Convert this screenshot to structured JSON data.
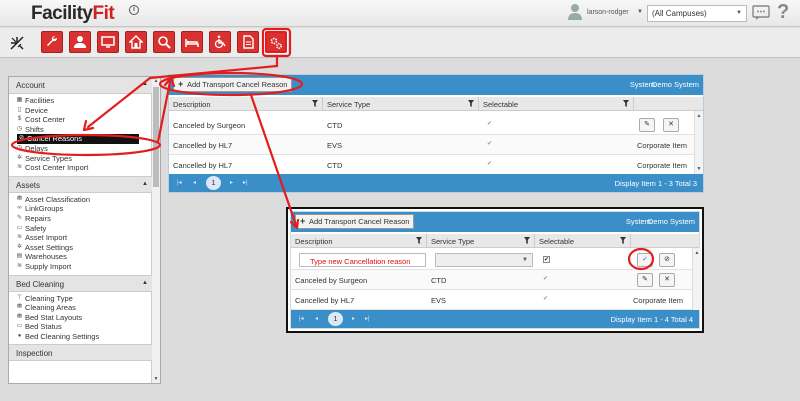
{
  "header": {
    "logo_main": "Facility",
    "logo_accent": "Fit",
    "logo_info": "i",
    "username": "larson-rodger",
    "campus_selected": "(All Campuses)",
    "help": "?"
  },
  "toolbar": {
    "buttons": [
      {
        "name": "wrench-icon"
      },
      {
        "name": "user-icon"
      },
      {
        "name": "monitor-icon"
      },
      {
        "name": "home-icon"
      },
      {
        "name": "search-icon"
      },
      {
        "name": "bed-icon"
      },
      {
        "name": "wheelchair-icon"
      },
      {
        "name": "document-icon"
      },
      {
        "name": "gears-icon"
      }
    ]
  },
  "sidebar": {
    "sections": [
      {
        "title": "Account",
        "items": [
          "Facilities",
          "Device",
          "Cost Center",
          "Shifts",
          "Cancel Reasons",
          "Delays",
          "Service Types",
          "Cost Center Import"
        ]
      },
      {
        "title": "Assets",
        "items": [
          "Asset Classification",
          "LinkGroups",
          "Repairs",
          "Safety",
          "Asset Import",
          "Asset Settings",
          "Warehouses",
          "Supply Import"
        ]
      },
      {
        "title": "Bed Cleaning",
        "items": [
          "Cleaning Type",
          "Cleaning Areas",
          "Bed Stat Layouts",
          "Bed Status",
          "Bed Cleaning Settings"
        ]
      },
      {
        "title": "Inspection",
        "items": []
      }
    ],
    "selected": "Cancel Reasons"
  },
  "grid1": {
    "add_label": "Add Transport Cancel Reason",
    "system_label": "System:",
    "system_value": "Demo System",
    "columns": [
      "Description",
      "Service Type",
      "Selectable"
    ],
    "rows": [
      {
        "description": "Canceled by Surgeon",
        "service_type": "CTD",
        "action": "buttons"
      },
      {
        "description": "Cancelled by HL7",
        "service_type": "EVS",
        "action": "Corporate Item"
      },
      {
        "description": "Cancelled by HL7",
        "service_type": "CTD",
        "action": "Corporate Item"
      }
    ],
    "page": "1",
    "display": "Display Item 1 - 3 Total 3"
  },
  "grid2": {
    "add_label": "Add Transport Cancel Reason",
    "system_label": "System:",
    "system_value": "Demo System",
    "columns": [
      "Description",
      "Service Type",
      "Selectable"
    ],
    "new_row_placeholder": "Type new Cancellation reason",
    "rows": [
      {
        "description": "Canceled by Surgeon",
        "service_type": "CTD",
        "action": "buttons"
      },
      {
        "description": "Cancelled by HL7",
        "service_type": "EVS",
        "action": "Corporate Item"
      }
    ],
    "page": "1",
    "display": "Display Item 1 - 4 Total 4"
  },
  "colors": {
    "accent_blue": "#3a8fc8",
    "toolbar_red": "#d93030",
    "callout_red": "#e21d1d"
  }
}
